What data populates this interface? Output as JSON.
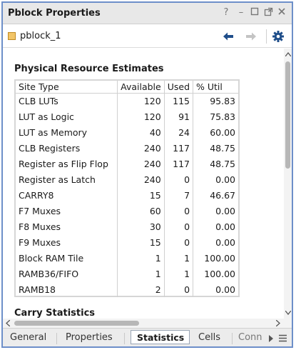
{
  "window": {
    "title": "Pblock Properties"
  },
  "window_controls": {
    "help": "?",
    "minimize": "–"
  },
  "object": {
    "name": "pblock_1"
  },
  "sections": {
    "resources_title": "Physical Resource Estimates",
    "carry_title": "Carry Statistics"
  },
  "table": {
    "headers": [
      "Site Type",
      "Available",
      "Used",
      "% Util"
    ],
    "rows": [
      [
        "CLB LUTs",
        "120",
        "115",
        "95.83"
      ],
      [
        "LUT as Logic",
        "120",
        "91",
        "75.83"
      ],
      [
        "LUT as Memory",
        "40",
        "24",
        "60.00"
      ],
      [
        "CLB Registers",
        "240",
        "117",
        "48.75"
      ],
      [
        "Register as Flip Flop",
        "240",
        "117",
        "48.75"
      ],
      [
        "Register as Latch",
        "240",
        "0",
        "0.00"
      ],
      [
        "CARRY8",
        "15",
        "7",
        "46.67"
      ],
      [
        "F7 Muxes",
        "60",
        "0",
        "0.00"
      ],
      [
        "F8 Muxes",
        "30",
        "0",
        "0.00"
      ],
      [
        "F9 Muxes",
        "15",
        "0",
        "0.00"
      ],
      [
        "Block RAM Tile",
        "1",
        "1",
        "100.00"
      ],
      [
        "RAMB36/FIFO",
        "1",
        "1",
        "100.00"
      ],
      [
        "RAMB18",
        "2",
        "0",
        "0.00"
      ]
    ]
  },
  "tabs": [
    {
      "label": "General",
      "active": false
    },
    {
      "label": "Properties",
      "active": false
    },
    {
      "label": "Statistics",
      "active": true
    },
    {
      "label": "Cells",
      "active": false
    },
    {
      "label": "Conn",
      "active": false
    }
  ],
  "colors": {
    "frame_border": "#6d8fc9",
    "nav_back": "#1f4e8a",
    "gear": "#1f4e8a",
    "pblock_icon": "#f2c567"
  }
}
